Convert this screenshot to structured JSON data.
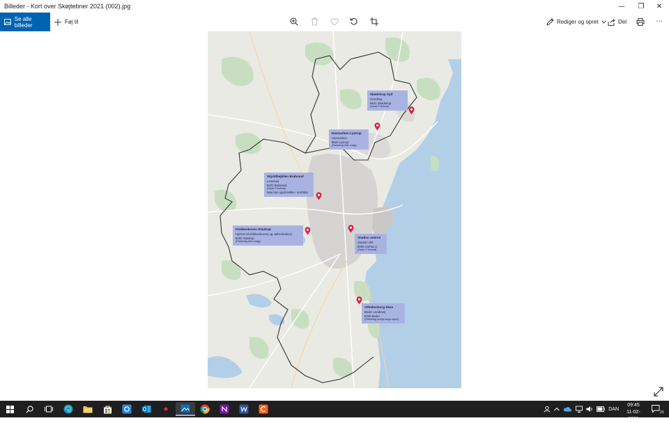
{
  "window": {
    "title": "Billeder - Kort over Skøjtebner 2021 (002).jpg",
    "minimize": "—",
    "maximize": "❐",
    "close": "✕"
  },
  "toolbar": {
    "see_all": "Se alle billeder",
    "add_to": "Føj til",
    "edit": "Rediger og opret",
    "share": "Del",
    "more": "···"
  },
  "map": {
    "locations": [
      {
        "name": "Skødstrup Syd",
        "lines": [
          "Grenåvej",
          "8541 Skødstrup"
        ],
        "note": "(Gode P forhold)"
      },
      {
        "name": "Havmarken Lystrup",
        "lines": [
          "Havmarken",
          "8520 Lystrup"
        ],
        "note": "(Parkering ikke mulig)"
      },
      {
        "name": "Skjoldhøjkilen Brabrand",
        "lines": [
          "Lenesvej",
          "8220 Brabrand"
        ],
        "note": "(Gode P forhold)",
        "extra": "Man kan også kælke i området"
      },
      {
        "name": "Klokkeskoven Stavtrup",
        "lines": [
          "Hjørnet af Klokkeskovvej og Jarlsmindevej",
          "8260 Stavtrup"
        ],
        "note": "(Parkering ikke mulig)"
      },
      {
        "name": "Stadion søerne",
        "lines": [
          "Stadion Allé",
          "8000 Aarhus C"
        ],
        "note": "(Gode P forhold)"
      },
      {
        "name": "Vilhelmsborg Skov",
        "lines": [
          "Beder Landevej",
          "8330 Beder"
        ],
        "note": "(Parkering muligt langs vejen)"
      }
    ]
  },
  "taskbar": {
    "language": "DAN",
    "time": "09:45",
    "date": "11-02-2021",
    "notification_count": "21"
  },
  "colors": {
    "accent": "#0063b1",
    "pin": "#d8244a",
    "label_bg": "#a9b3e2",
    "sea": "#b3cfe8",
    "forest": "#c7dfc0"
  }
}
